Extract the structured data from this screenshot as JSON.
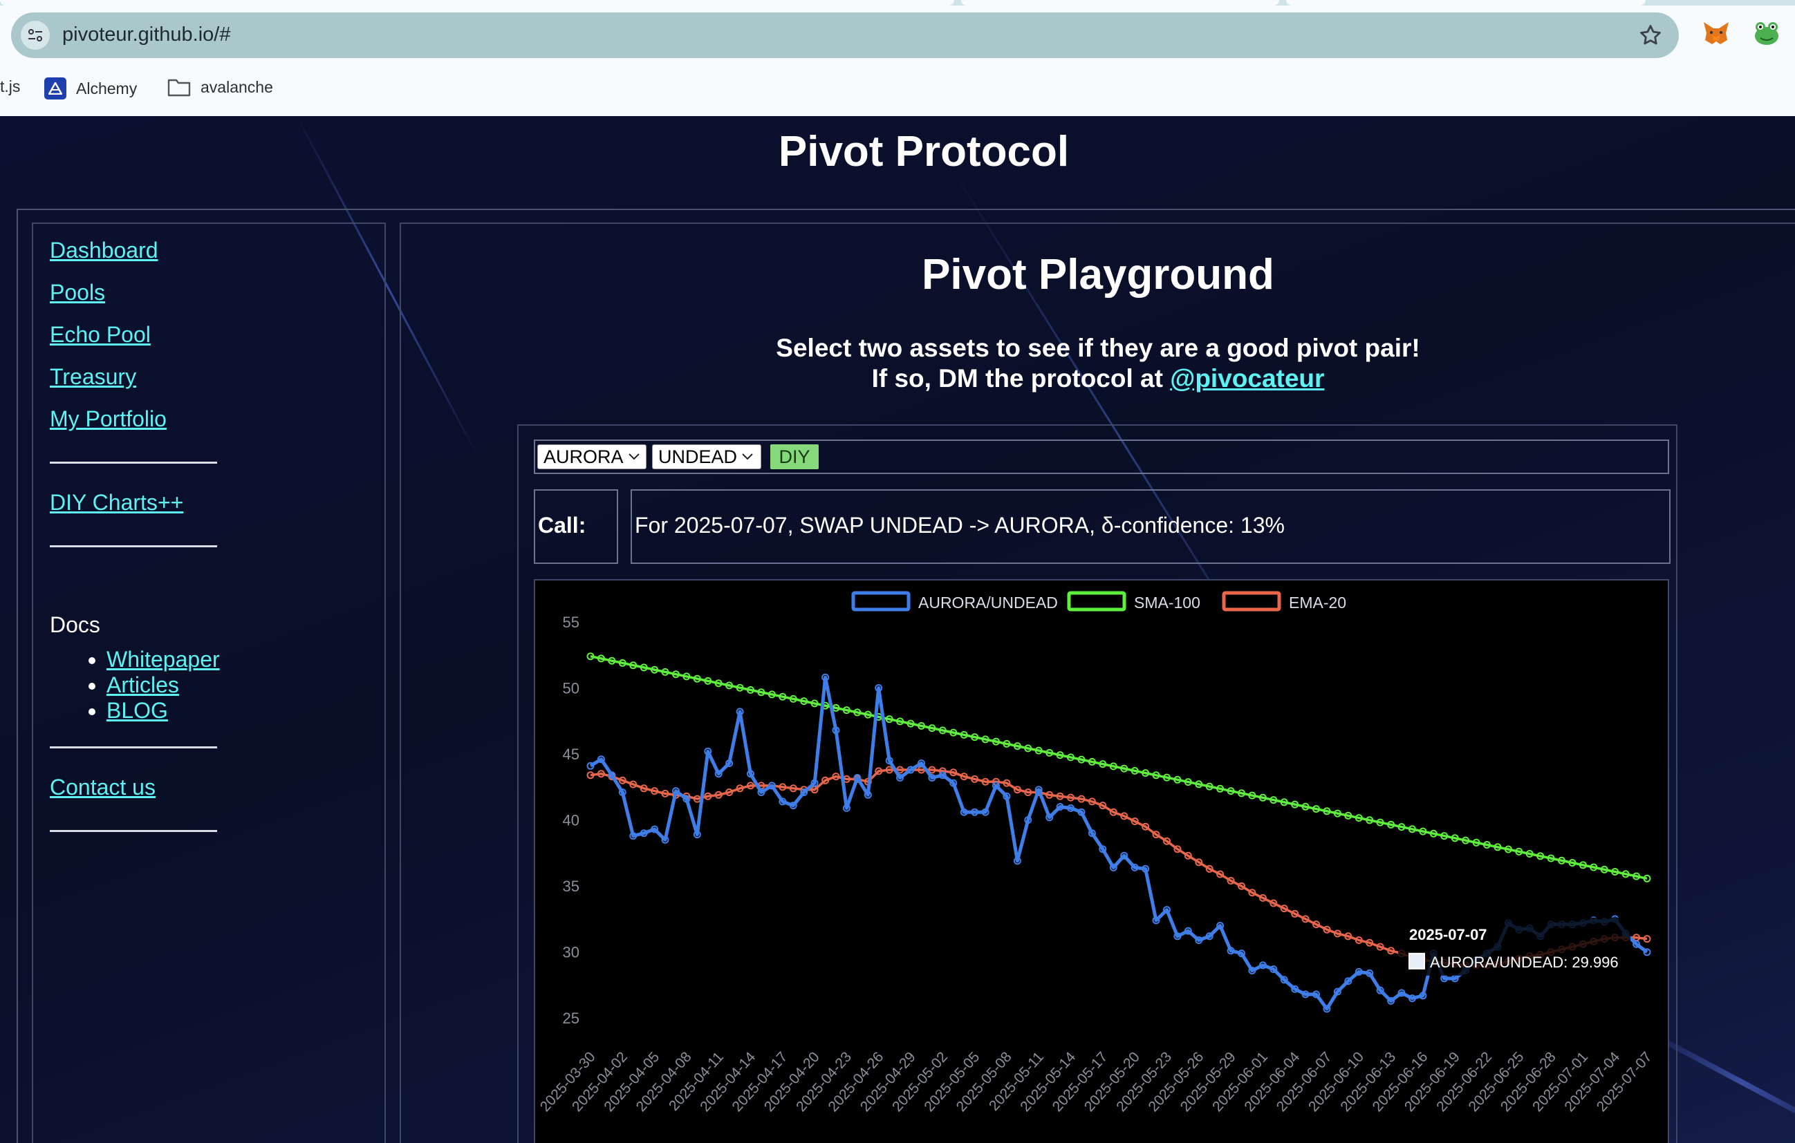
{
  "browser": {
    "url": "pivoteur.github.io/#",
    "bookmarks": [
      {
        "label": "t.js",
        "icon": "none"
      },
      {
        "label": "Alchemy",
        "icon": "alchemy-icon"
      },
      {
        "label": "avalanche",
        "icon": "folder-icon"
      }
    ],
    "extensions": [
      "metamask-fox-icon",
      "frog-extension-icon"
    ]
  },
  "site": {
    "title": "Pivot Protocol"
  },
  "sidebar": {
    "nav": [
      {
        "label": "Dashboard"
      },
      {
        "label": "Pools"
      },
      {
        "label": "Echo Pool"
      },
      {
        "label": "Treasury"
      },
      {
        "label": "My Portfolio"
      }
    ],
    "diy_link": "DIY Charts++",
    "docs_label": "Docs",
    "docs_items": [
      "Whitepaper",
      "Articles",
      "BLOG"
    ],
    "contact_link": "Contact us"
  },
  "main": {
    "title": "Pivot Playground",
    "subtitle_line1": "Select two assets to see if they are a good pivot pair!",
    "subtitle_line2_prefix": "If so, DM the protocol at ",
    "subtitle_handle": "@pivocateur",
    "asset_a": "AURORA",
    "asset_b": "UNDEAD",
    "diy_button": "DIY",
    "call_label": "Call:",
    "call_text": "For 2025-07-07, SWAP UNDEAD -> AURORA, δ-confidence: 13%"
  },
  "chart_data": {
    "type": "line",
    "legend_position": "top",
    "y_ticks": [
      25,
      30,
      35,
      40,
      45,
      50,
      55
    ],
    "ylim": [
      23.6,
      55
    ],
    "x_tick_labels": [
      "2025-03-30",
      "2025-04-02",
      "2025-04-05",
      "2025-04-08",
      "2025-04-11",
      "2025-04-14",
      "2025-04-17",
      "2025-04-20",
      "2025-04-23",
      "2025-04-26",
      "2025-04-29",
      "2025-05-02",
      "2025-05-05",
      "2025-05-08",
      "2025-05-11",
      "2025-05-14",
      "2025-05-17",
      "2025-05-20",
      "2025-05-23",
      "2025-05-26",
      "2025-05-29",
      "2025-06-01",
      "2025-06-04",
      "2025-06-07",
      "2025-06-10",
      "2025-06-13",
      "2025-06-16",
      "2025-06-19",
      "2025-06-22",
      "2025-06-25",
      "2025-06-28",
      "2025-07-01",
      "2025-07-04",
      "2025-07-07"
    ],
    "x_start": "2025-03-30",
    "x_end": "2025-07-07",
    "series": [
      {
        "name": "AURORA/UNDEAD",
        "color": "#3f7ee8",
        "values": [
          44.1,
          44.6,
          43.4,
          42.1,
          38.8,
          39.0,
          39.3,
          38.5,
          42.2,
          41.6,
          38.9,
          45.2,
          43.5,
          44.3,
          48.2,
          43.5,
          42.1,
          42.6,
          41.4,
          41.1,
          42.1,
          42.8,
          50.8,
          46.8,
          40.9,
          43.2,
          41.9,
          50.0,
          44.5,
          43.2,
          43.8,
          44.3,
          43.2,
          43.4,
          42.8,
          40.6,
          40.6,
          40.6,
          42.6,
          41.8,
          36.9,
          40.0,
          42.3,
          40.2,
          41.0,
          40.9,
          40.6,
          39.0,
          37.8,
          36.4,
          37.3,
          36.4,
          36.3,
          32.4,
          33.2,
          31.2,
          31.6,
          30.9,
          31.2,
          32.0,
          30.1,
          29.9,
          28.6,
          29.0,
          28.7,
          27.9,
          27.2,
          26.8,
          26.8,
          25.7,
          27.0,
          27.8,
          28.5,
          28.4,
          27.1,
          26.3,
          26.9,
          26.5,
          26.7,
          29.9,
          28.0,
          28.0,
          28.6,
          29.4,
          29.9,
          30.4,
          32.2,
          31.7,
          31.8,
          31.2,
          32.1,
          32.1,
          32.1,
          32.2,
          32.4,
          32.3,
          32.5,
          31.4,
          30.6,
          29.996
        ]
      },
      {
        "name": "SMA-100",
        "color": "#5ef03c",
        "values": [
          52.4,
          52.23,
          52.06,
          51.89,
          51.72,
          51.55,
          51.38,
          51.21,
          51.04,
          50.87,
          50.7,
          50.53,
          50.36,
          50.19,
          50.02,
          49.85,
          49.68,
          49.51,
          49.34,
          49.17,
          49.0,
          48.83,
          48.66,
          48.49,
          48.32,
          48.15,
          47.98,
          47.81,
          47.64,
          47.47,
          47.3,
          47.13,
          46.96,
          46.79,
          46.62,
          46.45,
          46.28,
          46.11,
          45.94,
          45.77,
          45.6,
          45.43,
          45.26,
          45.09,
          44.92,
          44.75,
          44.58,
          44.41,
          44.24,
          44.07,
          43.9,
          43.73,
          43.56,
          43.39,
          43.22,
          43.05,
          42.88,
          42.71,
          42.54,
          42.37,
          42.2,
          42.03,
          41.86,
          41.69,
          41.52,
          41.35,
          41.18,
          41.01,
          40.84,
          40.67,
          40.5,
          40.33,
          40.16,
          39.99,
          39.82,
          39.65,
          39.48,
          39.31,
          39.14,
          38.97,
          38.8,
          38.63,
          38.46,
          38.29,
          38.12,
          37.95,
          37.78,
          37.61,
          37.44,
          37.27,
          37.1,
          36.93,
          36.76,
          36.59,
          36.42,
          36.25,
          36.08,
          35.91,
          35.74,
          35.57
        ]
      },
      {
        "name": "EMA-20",
        "color": "#e8664a",
        "values": [
          43.4,
          43.5,
          43.3,
          43.0,
          42.7,
          42.4,
          42.2,
          42.0,
          41.9,
          41.8,
          41.6,
          41.8,
          41.9,
          42.1,
          42.4,
          42.6,
          42.6,
          42.6,
          42.5,
          42.4,
          42.3,
          42.3,
          43.0,
          43.3,
          43.1,
          43.1,
          42.9,
          43.7,
          43.8,
          43.8,
          43.8,
          43.8,
          43.8,
          43.7,
          43.6,
          43.3,
          43.1,
          42.9,
          42.9,
          42.8,
          42.3,
          42.1,
          42.1,
          41.9,
          41.8,
          41.7,
          41.6,
          41.4,
          41.1,
          40.6,
          40.3,
          39.9,
          39.5,
          38.9,
          38.4,
          37.8,
          37.3,
          36.8,
          36.3,
          35.9,
          35.4,
          35.0,
          34.5,
          34.1,
          33.7,
          33.3,
          32.9,
          32.5,
          32.1,
          31.7,
          31.4,
          31.2,
          30.9,
          30.7,
          30.4,
          30.1,
          29.9,
          29.6,
          29.4,
          29.3,
          29.2,
          29.1,
          29.0,
          29.0,
          29.0,
          29.1,
          29.3,
          29.5,
          29.7,
          29.8,
          30.0,
          30.2,
          30.4,
          30.6,
          30.8,
          31.0,
          31.1,
          31.1,
          31.1,
          31.0
        ]
      }
    ],
    "tooltip": {
      "title": "2025-07-07",
      "label": "AURORA/UNDEAD: 29.996"
    }
  }
}
